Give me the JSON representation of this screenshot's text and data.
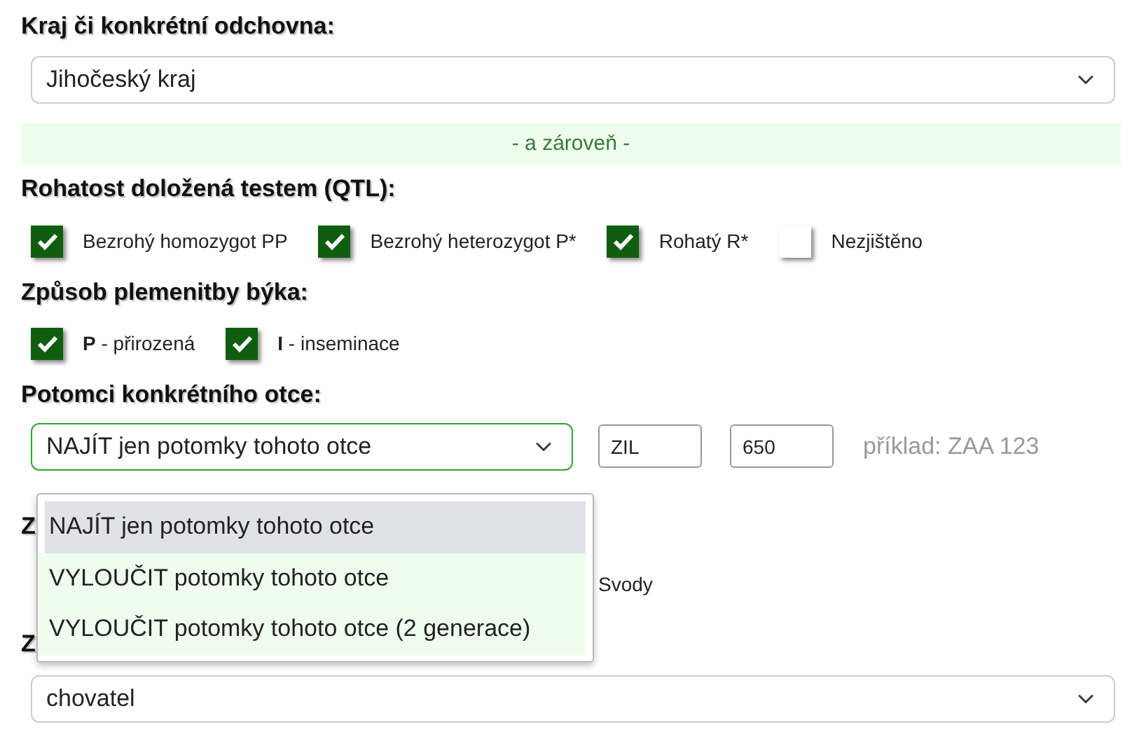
{
  "region": {
    "label": "Kraj či konkrétní odchovna:",
    "value": "Jihočeský kraj"
  },
  "separator": "- a zároveň -",
  "horns": {
    "label": "Rohatost doložená testem (QTL):",
    "options": [
      {
        "label": "Bezrohý homozygot PP",
        "checked": true
      },
      {
        "label": "Bezrohý heterozygot P*",
        "checked": true
      },
      {
        "label": "Rohatý R*",
        "checked": true
      },
      {
        "label": "Nezjištěno",
        "checked": false
      }
    ]
  },
  "breeding": {
    "label": "Způsob plemenitby býka:",
    "options": [
      {
        "label": "**P** - přirozená",
        "checked": true
      },
      {
        "label": "**I** - inseminace",
        "checked": true
      }
    ]
  },
  "sire": {
    "label": "Potomci konkrétního otce:",
    "mode": "NAJÍT jen potomky tohoto otce",
    "code": "ZIL",
    "number": "650",
    "hint": "příklad: ZAA 123",
    "dropdown": [
      {
        "label": "NAJÍT jen potomky tohoto otce",
        "selected": true
      },
      {
        "label": "VYLOUČIT potomky tohoto otce",
        "selected": false
      },
      {
        "label": "VYLOUČIT potomky tohoto otce (2 generace)",
        "selected": false
      }
    ]
  },
  "covered_section": {
    "label": "Z",
    "option": "Svody"
  },
  "display": {
    "label": "Z",
    "value": "chovatel"
  }
}
